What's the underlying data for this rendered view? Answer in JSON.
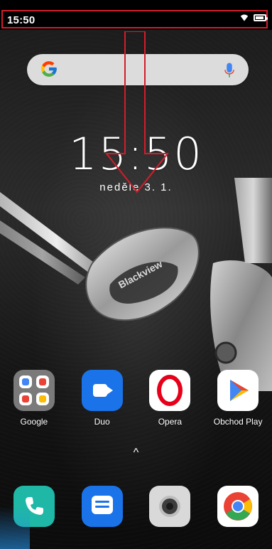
{
  "status_bar": {
    "time": "15:50",
    "wifi_icon": "wifi-icon",
    "battery_icon": "battery-icon"
  },
  "search": {
    "google_logo": "google-g-icon",
    "mic_icon": "microphone-icon"
  },
  "lockscreen": {
    "clock": "15:50",
    "date": "neděle 3. 1."
  },
  "wallpaper": {
    "brand": "Blackview"
  },
  "apps": [
    {
      "name": "Google",
      "icon": "google-folder-icon"
    },
    {
      "name": "Duo",
      "icon": "video-camera-icon"
    },
    {
      "name": "Opera",
      "icon": "opera-o-icon"
    },
    {
      "name": "Obchod Play",
      "icon": "play-store-triangle-icon"
    }
  ],
  "drawer": {
    "up_glyph": "^"
  },
  "dock": [
    {
      "icon": "phone-handset-icon"
    },
    {
      "icon": "messages-bubble-icon"
    },
    {
      "icon": "camera-lens-icon"
    },
    {
      "icon": "chrome-logo-icon"
    }
  ],
  "colors": {
    "highlight": "#d21d2b",
    "duo_blue": "#1a73e8",
    "opera_red": "#e6001a",
    "phone_green": "#1fb8a7",
    "search_bg": "#dcdcdc"
  }
}
